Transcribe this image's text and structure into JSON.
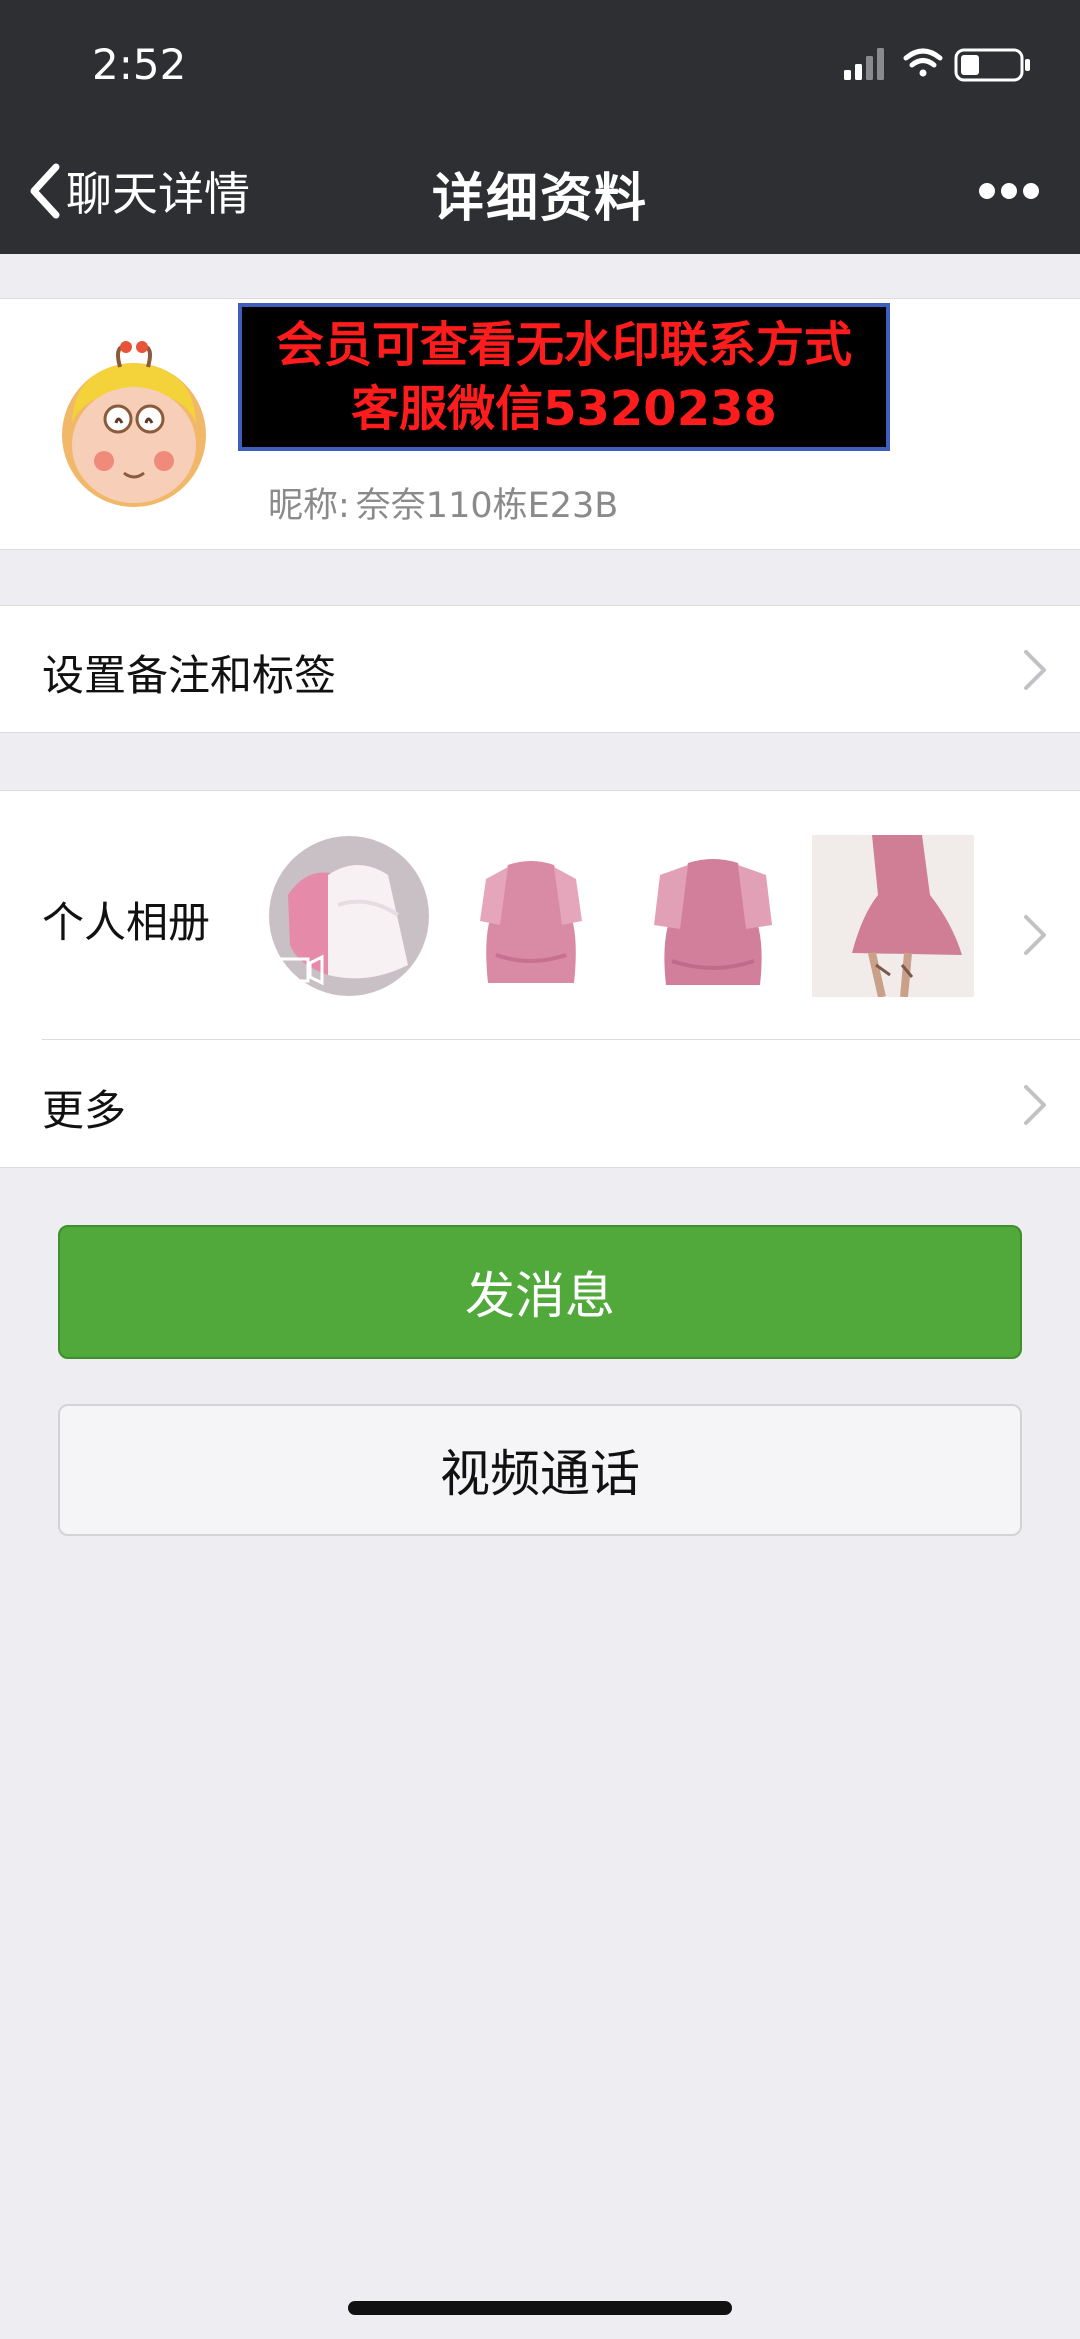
{
  "status_bar": {
    "time": "2:52"
  },
  "nav": {
    "back_label": "聊天详情",
    "title": "详细资料"
  },
  "profile": {
    "watermark_line1": "会员可查看无水印联系方式",
    "watermark_line2": "客服微信5320238",
    "nickname_label": "昵称:",
    "nickname_value": "奈奈110栋E23B"
  },
  "rows": {
    "remark_label": "设置备注和标签",
    "album_label": "个人相册",
    "more_label": "更多"
  },
  "buttons": {
    "message": "发消息",
    "video_call": "视频通话"
  },
  "colors": {
    "header_bg": "#2e2f32",
    "accent_green": "#50a93a",
    "watermark_red": "#ff1c1c"
  }
}
